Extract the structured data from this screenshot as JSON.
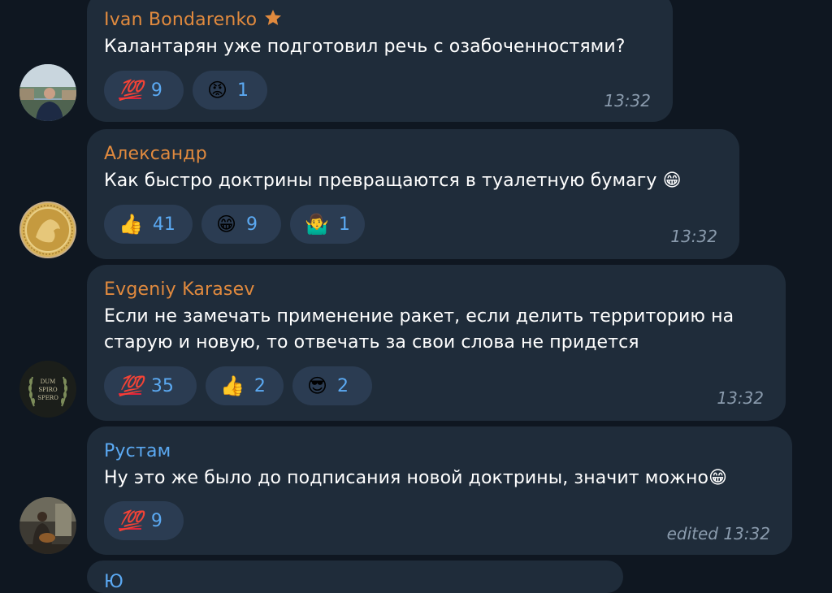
{
  "messages": [
    {
      "author": "Ivan Bondarenko",
      "author_color": "#e18a3e",
      "star_badge": true,
      "text": "Калантарян уже подготовил речь с озабоченностями?",
      "reactions": [
        {
          "emoji": "💯",
          "count": "9"
        },
        {
          "emoji": "😡",
          "count": "1"
        }
      ],
      "time": "13:32"
    },
    {
      "author": "Александр",
      "author_color": "#e18a3e",
      "text": "Как быстро доктрины превращаются в туалетную бумагу 😁",
      "reactions": [
        {
          "emoji": "👍",
          "count": "41"
        },
        {
          "emoji": "😁",
          "count": "9"
        },
        {
          "emoji": "🤷‍♂️",
          "count": "1"
        }
      ],
      "time": "13:32"
    },
    {
      "author": "Evgeniy Karasev",
      "author_color": "#e18a3e",
      "text_line1": "Если не замечать применение ракет, если делить территорию на",
      "text_line2": "старую и новую, то отвечать за свои слова не придется",
      "reactions": [
        {
          "emoji": "💯",
          "count": "35"
        },
        {
          "emoji": "👍",
          "count": "2"
        },
        {
          "emoji": "😎",
          "count": "2"
        }
      ],
      "time": "13:32",
      "avatar_text": [
        "DUM",
        "SPIRO",
        "SPERO"
      ]
    },
    {
      "author": "Рустам",
      "author_color": "#5ba9f2",
      "text": "Ну это же было до подписания новой доктрины, значит можно😁",
      "reactions": [
        {
          "emoji": "💯",
          "count": "9"
        }
      ],
      "time": "edited 13:32"
    }
  ],
  "partial_author": "Ю"
}
